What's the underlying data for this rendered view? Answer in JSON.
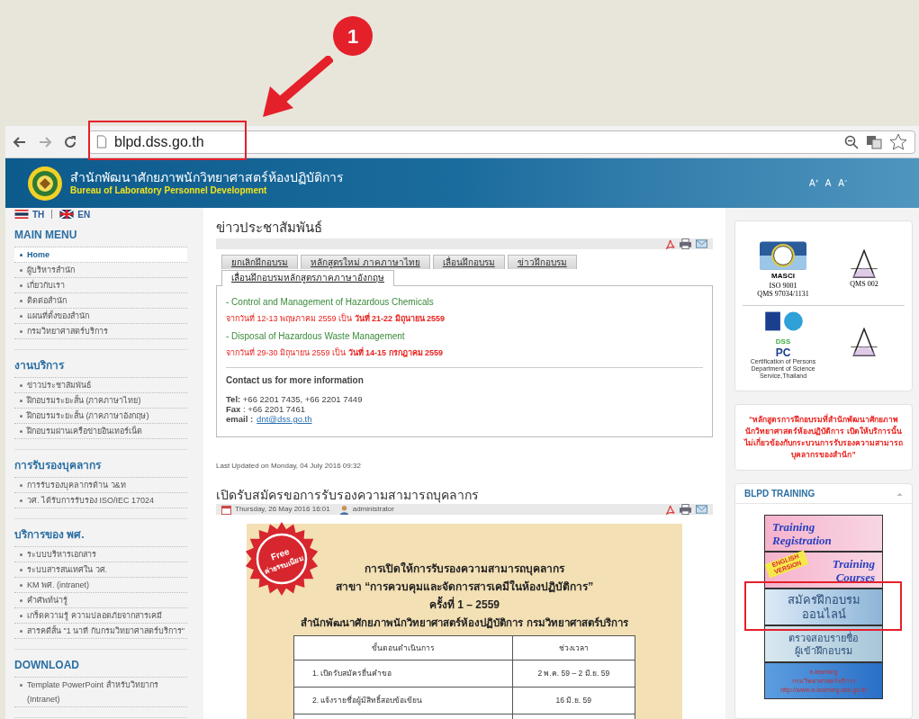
{
  "annotation": {
    "step": "1"
  },
  "browser": {
    "url": "blpd.dss.go.th",
    "url_highlighted": true
  },
  "header": {
    "title_th": "สำนักพัฒนาศักยภาพนักวิทยาศาสตร์ห้องปฏิบัติการ",
    "title_en": "Bureau of Laboratory Personnel Development",
    "font_size_controls": [
      "A⁺",
      "A",
      "A⁻"
    ]
  },
  "languages": [
    {
      "label": "TH",
      "kind": "th"
    },
    {
      "label": "EN",
      "kind": "uk"
    }
  ],
  "sidebar": [
    {
      "title": "MAIN MENU",
      "items": [
        {
          "label": "Home",
          "selected": true
        },
        {
          "label": "ผู้บริหารสำนัก",
          "selected": false
        },
        {
          "label": "เกี่ยวกับเรา",
          "selected": false
        },
        {
          "label": "ติดต่อสำนัก",
          "selected": false
        },
        {
          "label": "แผนที่ตั้งของสำนัก",
          "selected": false
        },
        {
          "label": "กรมวิทยาศาสตร์บริการ",
          "selected": false
        }
      ]
    },
    {
      "title": "งานบริการ",
      "items": [
        {
          "label": "ข่าวประชาสัมพันธ์",
          "selected": false
        },
        {
          "label": "ฝึกอบรมระยะสั้น (ภาคภาษาไทย)",
          "selected": false
        },
        {
          "label": "ฝึกอบรมระยะสั้น (ภาคภาษาอังกฤษ)",
          "selected": false
        },
        {
          "label": "ฝึกอบรมผ่านเครือข่ายอินเทอร์เน็ต",
          "selected": false
        }
      ]
    },
    {
      "title": "การรับรองบุคลากร",
      "items": [
        {
          "label": "การรับรองบุคลากรด้าน ว&ท",
          "selected": false
        },
        {
          "label": "วศ. ได้รับการรับรอง ISO/IEC 17024",
          "selected": false
        }
      ]
    },
    {
      "title": "บริการของ พศ.",
      "items": [
        {
          "label": "ระบบบริหารเอกสาร",
          "selected": false
        },
        {
          "label": "ระบบสารสนเทศใน วศ.",
          "selected": false
        },
        {
          "label": "KM พศ. (intranet)",
          "selected": false
        },
        {
          "label": "คำศัพท์น่ารู้",
          "selected": false
        },
        {
          "label": "เกร็ดความรู้ ความปลอดภัยจากสารเคมี",
          "selected": false
        },
        {
          "label": "สารคดีสั้น \"1 นาที กับกรมวิทยาศาสตร์บริการ\"",
          "selected": false
        }
      ]
    },
    {
      "title": "DOWNLOAD",
      "items": [
        {
          "label": "Template PowerPoint สำหรับวิทยากร (Intranet)",
          "selected": false
        }
      ]
    }
  ],
  "news": {
    "title": "ข่าวประชาสัมพันธ์",
    "tabs": [
      {
        "label": "ยกเลิกฝึกอบรม",
        "selected": false
      },
      {
        "label": "หลักสูตรใหม่ ภาคภาษาไทย",
        "selected": false
      },
      {
        "label": "เลื่อนฝึกอบรม",
        "selected": false
      },
      {
        "label": "ข่าวฝึกอบรม",
        "selected": false
      },
      {
        "label": "เลื่อนฝึกอบรมหลักสูตรภาคภาษาอังกฤษ",
        "selected": true
      }
    ],
    "entries": [
      {
        "kind": "course",
        "text": "- Control and Management of Hazardous Chemicals"
      },
      {
        "kind": "date",
        "text": "จากวันที่ 12-13 พฤษภาคม 2559 เป็น **วันที่ 21-22 มิถุนายน 2559**"
      },
      {
        "kind": "course",
        "text": "- Disposal of Hazardous Waste Management"
      },
      {
        "kind": "date",
        "text": "จากวันที่ 29-30 มิถุนายน 2559 เป็น **วันที่ 14-15 กรกฎาคม 2559**"
      }
    ],
    "contact_heading": "Contact us for more information",
    "contact_lines": [
      "**Tel:** +66 2201 7435, +66 2201 7449",
      "**Fax** : +66 2201 7461"
    ],
    "email_label": "email :",
    "email": "dnt@dss.go.th",
    "last_updated": "Last Updated on Monday, 04 July 2016 09:32"
  },
  "article": {
    "title": "เปิดรับสมัครขอการรับรองความสามารถบุคลากร",
    "date": "Thursday, 26 May 2016 16:01",
    "author": "administrator",
    "poster": {
      "badge": [
        "Free",
        "ค่าธรรมเนียม"
      ],
      "lines": [
        "การเปิดให้การรับรองความสามารถบุคลากร",
        "สาขา “การควบคุมและจัดการสารเคมีในห้องปฏิบัติการ”",
        "ครั้งที่ 1 – 2559",
        "สำนักพัฒนาศักยภาพนักวิทยาศาสตร์ห้องปฏิบัติการ กรมวิทยาศาสตร์บริการ"
      ],
      "columns": [
        "ขั้นตอนดำเนินการ",
        "ช่วงเวลา"
      ],
      "rows": [
        [
          "1. เปิดรับสมัครยื่นคำขอ",
          "2 พ.ค. 59 – 2 มิ.ย. 59"
        ],
        [
          "2. แจ้งรายชื่อผู้มีสิทธิ์สอบข้อเขียน",
          "16 มิ.ย. 59"
        ]
      ]
    }
  },
  "certifications": [
    {
      "kind": "masci",
      "texts": [
        "MASCI",
        "ISO 9001",
        "QMS 97034/1131"
      ]
    },
    {
      "kind": "nac",
      "texts": [
        "QMS 002"
      ]
    },
    {
      "kind": "pc",
      "texts": [
        "DSS",
        "PC",
        "Certification of Persons",
        "Department of Science Service,Thailand"
      ]
    },
    {
      "kind": "nac"
    }
  ],
  "notice": "“หลักสูตรการฝึกอบรมที่สำนักพัฒนาศักยภาพนักวิทยาศาสตร์ห้องปฏิบัติการ เปิดให้บริการนั้น ไม่เกี่ยวข้องกับกระบวนการรับรองความสามารถบุคลากรของสำนัก”",
  "training": {
    "title": "BLPD TRAINING",
    "banners": [
      {
        "kind": "registration",
        "lines": [
          "Training",
          "Registration"
        ],
        "highlighted": false
      },
      {
        "kind": "courses",
        "badge": "ENGLISH VERSION",
        "lines": [
          "Training",
          "Courses"
        ],
        "highlighted": false
      },
      {
        "kind": "online",
        "lines": [
          "สมัครฝึกอบรม",
          "ออนไลน์"
        ],
        "highlighted": true
      },
      {
        "kind": "check",
        "lines": [
          "ตรวจสอบรายชื่อ",
          "ผู้เข้าฝึกอบรม"
        ],
        "highlighted": false
      },
      {
        "kind": "elearning",
        "lines": [
          "e-learning",
          "กรมวิทยาศาสตร์บริการ",
          "http://www.e-learning.dss.go.th"
        ],
        "highlighted": false
      }
    ]
  }
}
